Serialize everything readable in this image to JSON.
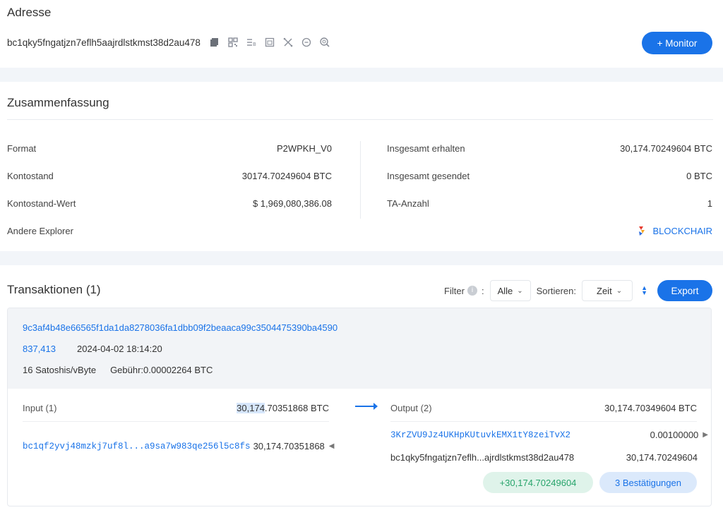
{
  "address_section": {
    "title": "Adresse",
    "address": "bc1qky5fngatjzn7eflh5aajrdlstkmst38d2au478",
    "monitor_label": "+ Monitor"
  },
  "summary": {
    "title": "Zusammenfassung",
    "left": [
      {
        "label": "Format",
        "value": "P2WPKH_V0"
      },
      {
        "label": "Kontostand",
        "value": "30174.70249604 BTC"
      },
      {
        "label": "Kontostand-Wert",
        "value": "$ 1,969,080,386.08"
      },
      {
        "label": "Andere Explorer",
        "value": ""
      }
    ],
    "right": [
      {
        "label": "Insgesamt erhalten",
        "value": "30,174.70249604 BTC"
      },
      {
        "label": "Insgesamt gesendet",
        "value": "0 BTC"
      },
      {
        "label": "TA-Anzahl",
        "value": "1"
      }
    ],
    "explorer_link": "BLOCKCHAIR"
  },
  "transactions": {
    "title": "Transaktionen (1)",
    "filter_label": "Filter",
    "filter_colon": ":",
    "filter_value": "Alle",
    "sort_label": "Sortieren:",
    "sort_value": "Zeit",
    "export_label": "Export",
    "tx": {
      "hash": "9c3af4b48e66565f1da1da8278036fa1dbb09f2beaaca99c3504475390ba4590",
      "block": "837,413",
      "time": "2024-04-02 18:14:20",
      "fee_rate": "16 Satoshis/vByte",
      "fee": "Gebühr:0.00002264 BTC",
      "input_label": "Input (1)",
      "input_total_hl": "30,174",
      "input_total_rest": ".70351868 BTC",
      "inputs": [
        {
          "address": "bc1qf2yvj48mzkj7uf8l...a9sa7w983qe256l5c8fs",
          "amount": "30,174.70351868"
        }
      ],
      "output_label": "Output (2)",
      "output_total": "30,174.70349604 BTC",
      "outputs": [
        {
          "address": "3KrZVU9Jz4UKHpKUtuvkEMX1tY8zeiTvX2",
          "amount": "0.00100000"
        },
        {
          "address": "bc1qky5fngatjzn7eflh...ajrdlstkmst38d2au478",
          "amount": "30,174.70249604"
        }
      ],
      "net_change": "+30,174.70249604",
      "confirmations": "3 Bestätigungen"
    }
  },
  "colors": {
    "accent": "#1a73e8",
    "green": "#27a46b",
    "background": "#f2f5f9"
  },
  "icons": [
    "copy-icon",
    "qr-code-icon",
    "format-icon",
    "calendar-icon",
    "shuffle-icon",
    "refresh-icon",
    "search-icon",
    "info-icon",
    "chevron-down-icon",
    "sort-icon",
    "arrow-right-icon",
    "blockchair-logo"
  ]
}
